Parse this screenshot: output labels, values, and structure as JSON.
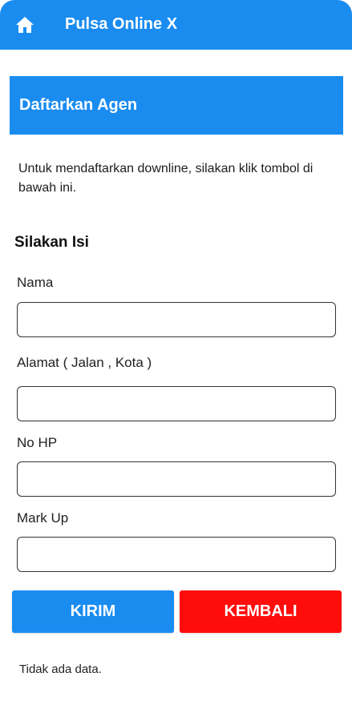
{
  "app_bar": {
    "title": "Pulsa Online X",
    "home_icon": "home-icon",
    "color": "#1a8cf0"
  },
  "section": {
    "title": "Daftarkan Agen",
    "color": "#1a8cf0"
  },
  "description": "Untuk mendaftarkan downline, silakan klik tombol di bawah ini.",
  "form": {
    "heading": "Silakan Isi",
    "fields": [
      {
        "label": "Nama",
        "value": ""
      },
      {
        "label": "Alamat ( Jalan , Kota )",
        "value": ""
      },
      {
        "label": "No HP",
        "value": ""
      },
      {
        "label": "Mark Up",
        "value": ""
      }
    ]
  },
  "buttons": {
    "submit_label": "KIRIM",
    "submit_color": "#1a8cf0",
    "back_label": "KEMBALI",
    "back_color": "#ff0d0d"
  },
  "status": {
    "empty_text": "Tidak ada data."
  }
}
